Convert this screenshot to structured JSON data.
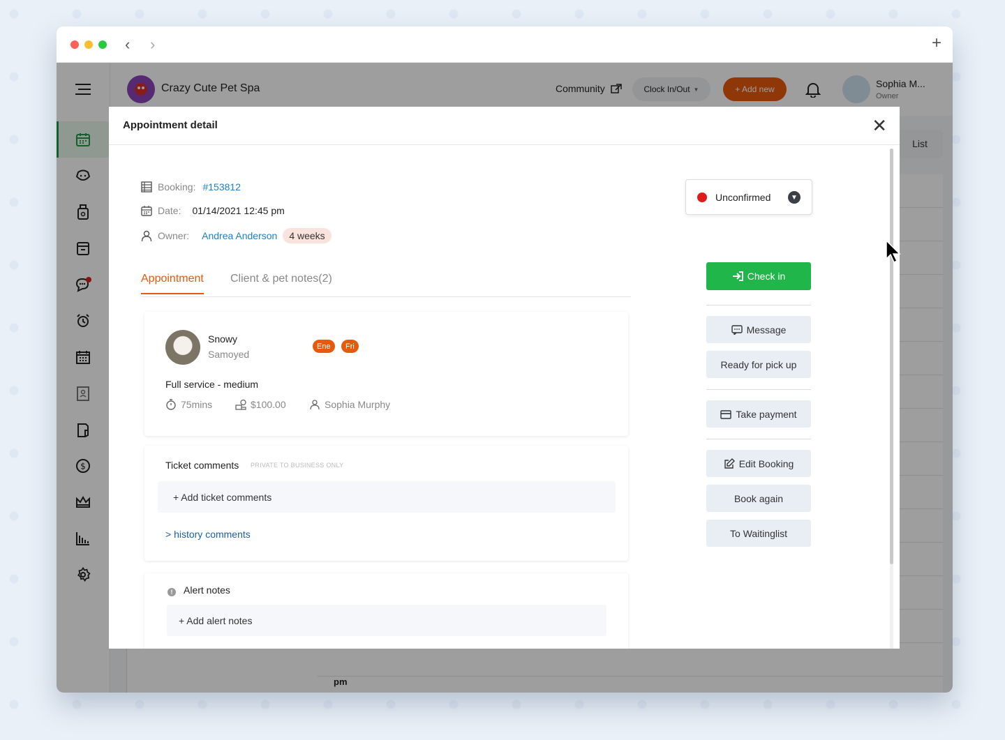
{
  "app": {
    "business_name": "Crazy Cute Pet Spa",
    "community_label": "Community",
    "clock_label": "Clock In/Out",
    "add_new_label": "+ Add new",
    "user_name": "Sophia M...",
    "user_role": "Owner",
    "view_toggle": "List",
    "calendar_pm_label": "pm"
  },
  "modal": {
    "title": "Appointment detail",
    "booking_label": "Booking:",
    "booking_id": "#153812",
    "date_label": "Date:",
    "date_value": "01/14/2021 12:45 pm",
    "owner_label": "Owner:",
    "owner_name": "Andrea Anderson",
    "owner_badge": "4 weeks",
    "status": {
      "label": "Unconfirmed",
      "color": "#e01b1b"
    },
    "tabs": [
      {
        "label": "Appointment",
        "active": true
      },
      {
        "label": "Client & pet notes(2)",
        "active": false
      }
    ],
    "pet": {
      "name": "Snowy",
      "breed": "Samoyed",
      "tags": [
        "Ene",
        "Fri"
      ],
      "service": "Full service - medium",
      "duration": "75mins",
      "price": "$100.00",
      "staff": "Sophia Murphy"
    },
    "ticket_comments": {
      "title": "Ticket comments",
      "private_note": "PRIVATE TO BUSINESS ONLY",
      "add_label": "+ Add ticket comments",
      "history_label": "> history comments"
    },
    "alert_notes": {
      "title": "Alert notes",
      "add_label": "+ Add alert notes"
    },
    "actions": {
      "check_in": "Check in",
      "message": "Message",
      "ready": "Ready for pick up",
      "take_payment": "Take payment",
      "edit_booking": "Edit Booking",
      "book_again": "Book again",
      "waitinglist": "To Waitinglist"
    }
  },
  "colors": {
    "accent_orange": "#e8590c",
    "check_in_green": "#20b64a",
    "link_blue": "#1f7ec8",
    "sidebar_active": "#1e9d4a"
  }
}
